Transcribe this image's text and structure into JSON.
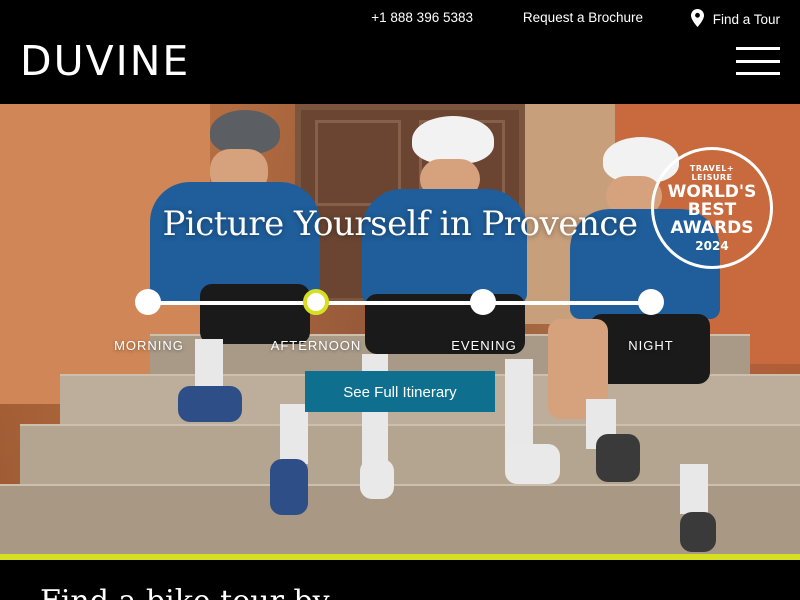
{
  "brand": {
    "logo": "DUVINE"
  },
  "topnav": {
    "phone": "+1 888 396 5383",
    "brochure": "Request a Brochure",
    "find_tour": "Find a Tour"
  },
  "hero": {
    "title": "Picture Yourself in Provence",
    "timeline": [
      {
        "label": "MORNING",
        "active": false
      },
      {
        "label": "AFTERNOON",
        "active": true
      },
      {
        "label": "EVENING",
        "active": false
      },
      {
        "label": "NIGHT",
        "active": false
      }
    ],
    "cta_label": "See Full Itinerary",
    "award": {
      "line1": "TRAVEL+",
      "line1b": "LEISURE",
      "line2": "WORLD'S",
      "line3": "BEST",
      "line4": "AWARDS",
      "line5": "2024"
    }
  },
  "section": {
    "heading": "Find a bike tour by"
  },
  "colors": {
    "accent": "#d7df23",
    "cta": "#0e6f8f",
    "header_bg": "#000000"
  },
  "icons": {
    "location": "map-pin-icon",
    "menu": "hamburger-menu-icon"
  }
}
